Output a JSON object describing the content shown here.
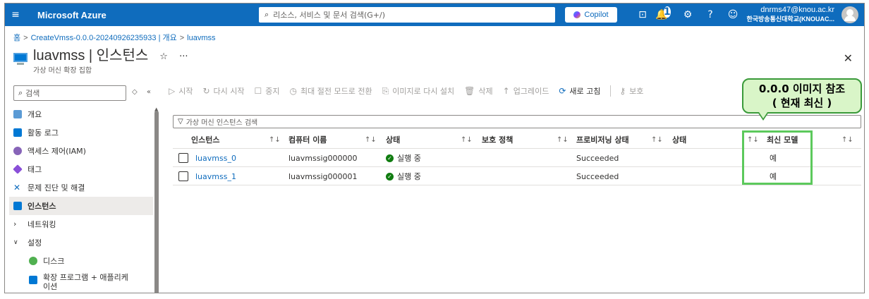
{
  "topbar": {
    "brand": "Microsoft Azure",
    "search_placeholder": "리소스, 서비스 및 문서 검색(G+/)",
    "copilot_label": "Copilot",
    "notification_count": "1",
    "account_email": "dnrms47@knou.ac.kr",
    "account_org": "한국방송통신대학교(KNOUAC..."
  },
  "breadcrumb": {
    "home": "홈",
    "item1": "CreateVmss-0.0.0-20240926235933 | 개요",
    "item2": "luavmss"
  },
  "header": {
    "title": "luavmss | 인스턴스",
    "subtitle": "가상 머신 확장 집합",
    "star": "☆",
    "more": "···",
    "close": "✕"
  },
  "nav": {
    "search_placeholder": "검색",
    "items": [
      {
        "label": "개요",
        "color": "#5b9bd5"
      },
      {
        "label": "활동 로그",
        "color": "#0078d4"
      },
      {
        "label": "액세스 제어(IAM)",
        "color": "#8764b8"
      },
      {
        "label": "태그",
        "color": "#8a4fd8"
      },
      {
        "label": "문제 진단 및 해결",
        "color": "#0f6cbd"
      },
      {
        "label": "인스턴스",
        "color": "#0078d4"
      },
      {
        "label": "네트워킹",
        "color": ""
      },
      {
        "label": "설정",
        "color": ""
      },
      {
        "label": "디스크",
        "color": "#50b050"
      },
      {
        "label": "확장 프로그램 + 애플리케이션",
        "color": "#0078d4"
      }
    ]
  },
  "toolbar": {
    "start": "시작",
    "restart": "다시 시작",
    "stop": "중지",
    "hibernate": "최대 절전 모드로 전환",
    "reimage": "이미지로 다시 설치",
    "delete": "삭제",
    "upgrade": "업그레이드",
    "refresh": "새로 고침",
    "protect": "보호"
  },
  "filter": {
    "placeholder": "가상 머신 인스턴스 검색"
  },
  "table": {
    "headers": {
      "instance": "인스턴스",
      "computer_name": "컴퓨터 이름",
      "status": "상태",
      "protection_policy": "보호 정책",
      "provisioning_state": "프로비저닝 상태",
      "state": "상태",
      "latest_model": "최신 모델"
    },
    "rows": [
      {
        "instance": "luavmss_0",
        "computer_name": "luavmssig000000",
        "status": "실행 중",
        "provisioning_state": "Succeeded",
        "latest_model": "예"
      },
      {
        "instance": "luavmss_1",
        "computer_name": "luavmssig000001",
        "status": "실행 중",
        "provisioning_state": "Succeeded",
        "latest_model": "예"
      }
    ]
  },
  "annotation": {
    "line1": "0.0.0 이미지 참조",
    "line2": "( 현재 최신 )"
  },
  "colors": {
    "azure_blue": "#0f6cbd",
    "highlight_green": "#5cc95c",
    "callout_fill": "#d9f5c8",
    "status_green": "#107c10"
  }
}
